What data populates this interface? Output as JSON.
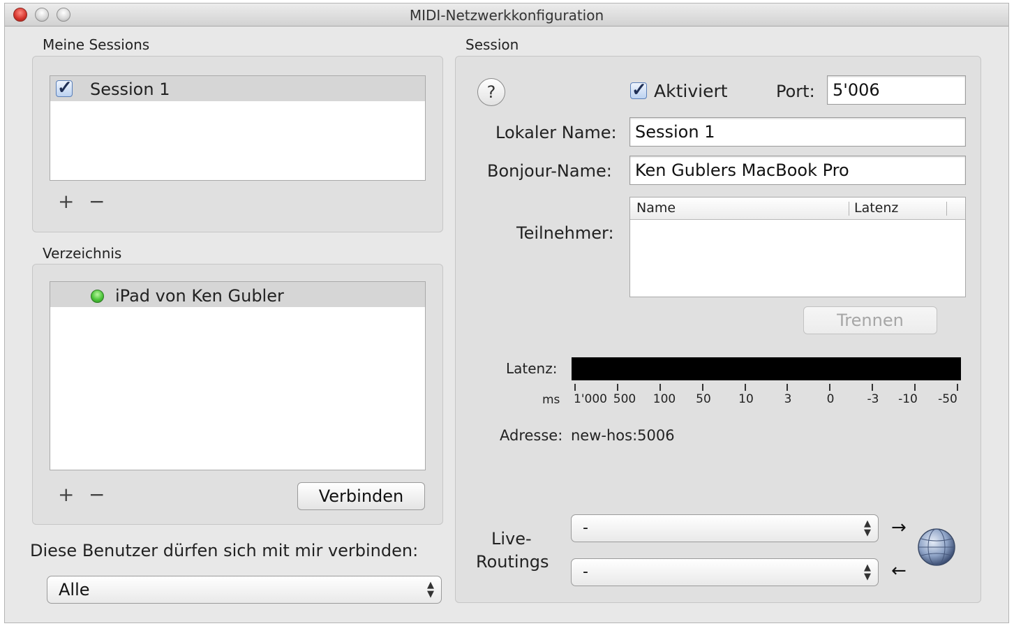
{
  "window": {
    "title": "MIDI-Netzwerkkonfiguration"
  },
  "sessions": {
    "title": "Meine Sessions",
    "items": [
      {
        "label": "Session 1",
        "checked": true
      }
    ],
    "add": "+",
    "remove": "−"
  },
  "directory": {
    "title": "Verzeichnis",
    "items": [
      {
        "label": "iPad von Ken Gubler",
        "status": "online",
        "status_color": "#4cc53a"
      }
    ],
    "add": "+",
    "remove": "−",
    "connect_label": "Verbinden"
  },
  "permissions": {
    "label": "Diese Benutzer dürfen sich mit mir verbinden:",
    "selected": "Alle"
  },
  "session": {
    "title": "Session",
    "help": "?",
    "enabled_label": "Aktiviert",
    "enabled": true,
    "port_label": "Port:",
    "port_value": "5'006",
    "local_name_label": "Lokaler Name:",
    "local_name_value": "Session 1",
    "bonjour_label": "Bonjour-Name:",
    "bonjour_value": "Ken Gublers MacBook Pro",
    "participants_label": "Teilnehmer:",
    "participants_columns": [
      "Name",
      "Latenz"
    ],
    "participants": [],
    "disconnect_label": "Trennen",
    "latency_label": "Latenz:",
    "latency_unit": "ms",
    "latency_ticks": [
      "1'000",
      "500",
      "100",
      "50",
      "10",
      "3",
      "0",
      "-3",
      "-10",
      "-50"
    ],
    "address_label": "Adresse:",
    "address_value": "new-hos:5006",
    "live_routing_label_1": "Live-",
    "live_routing_label_2": "Routings",
    "routing_in_value": "-",
    "routing_out_value": "-"
  }
}
